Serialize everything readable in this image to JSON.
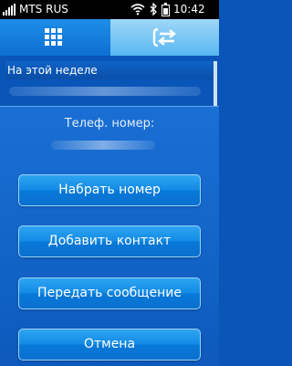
{
  "status_bar": {
    "carrier": "MTS RUS",
    "time": "10:42",
    "icons": [
      "signal-icon",
      "wifi-icon",
      "bluetooth-icon",
      "battery-icon"
    ]
  },
  "tabs": [
    {
      "name": "dialpad",
      "icon": "grid-icon",
      "active": false
    },
    {
      "name": "calls",
      "icon": "swap-arrows-icon",
      "active": true
    }
  ],
  "list": {
    "section_header": "На этой неделе"
  },
  "dialog": {
    "title": "Телеф. номер:",
    "buttons": {
      "dial": "Набрать номер",
      "add_contact": "Добавить контакт",
      "send_message": "Передать сообщение",
      "cancel": "Отмена"
    }
  },
  "colors": {
    "background": "#0a55b8",
    "dialog": "#1364c8",
    "button": "#138be5",
    "active_tab": "#58b7f2"
  }
}
